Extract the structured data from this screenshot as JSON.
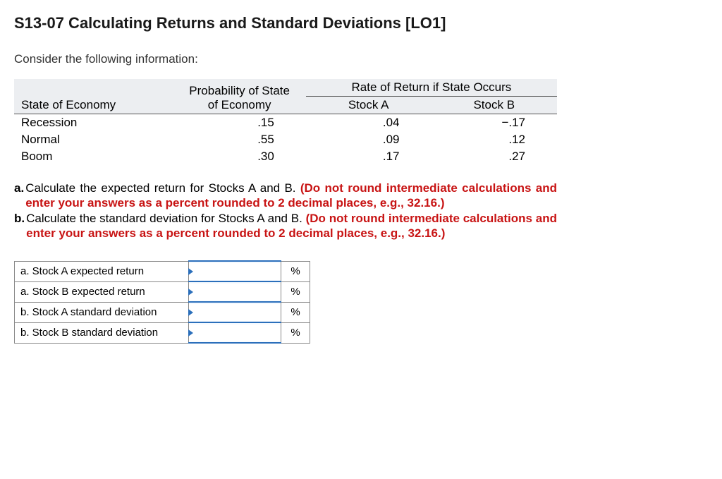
{
  "title": "S13-07 Calculating Returns and Standard Deviations [LO1]",
  "intro": "Consider the following information:",
  "table": {
    "ror_header": "Rate of Return if State Occurs",
    "col_state": "State of Economy",
    "col_prob_line1": "Probability of State",
    "col_prob_line2": "of Economy",
    "col_stock_a": "Stock A",
    "col_stock_b": "Stock B",
    "rows": [
      {
        "state": "Recession",
        "prob": ".15",
        "a": ".04",
        "b": "−.17"
      },
      {
        "state": "Normal",
        "prob": ".55",
        "a": ".09",
        "b": ".12"
      },
      {
        "state": "Boom",
        "prob": ".30",
        "a": ".17",
        "b": ".27"
      }
    ]
  },
  "questions": {
    "a_letter": "a.",
    "a_text": "Calculate the expected return for Stocks A and B. ",
    "a_red": "(Do not round intermediate calculations and enter your answers as a percent rounded to 2 decimal places, e.g., 32.16.)",
    "b_letter": "b.",
    "b_text": "Calculate the standard deviation for Stocks A and B. ",
    "b_red": "(Do not round intermediate calculations and enter your answers as a percent rounded to 2 decimal places, e.g., 32.16.)"
  },
  "answers": {
    "rows": [
      {
        "label": "a. Stock A expected return",
        "unit": "%"
      },
      {
        "label": "a. Stock B expected return",
        "unit": "%"
      },
      {
        "label": "b. Stock A standard deviation",
        "unit": "%"
      },
      {
        "label": "b. Stock B standard deviation",
        "unit": "%"
      }
    ]
  }
}
